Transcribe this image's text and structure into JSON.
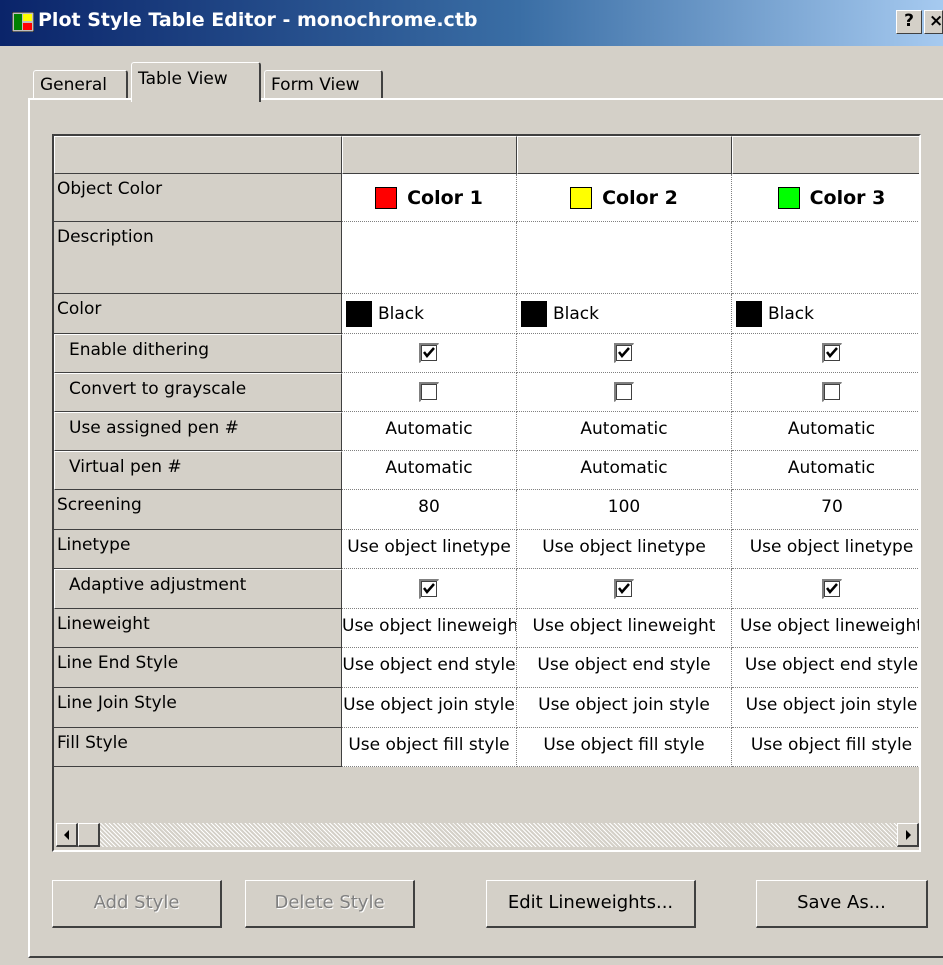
{
  "window": {
    "title": "Plot Style Table Editor - monochrome.ctb",
    "help_label": "?",
    "close_label": "×"
  },
  "tabs": [
    {
      "label": "General",
      "active": false
    },
    {
      "label": "Table View",
      "active": true
    },
    {
      "label": "Form View",
      "active": false
    }
  ],
  "row_labels": {
    "object_color": "Object Color",
    "description": "Description",
    "color": "Color",
    "enable_dithering": "Enable dithering",
    "convert_grayscale": "Convert to grayscale",
    "use_assigned_pen": "Use assigned pen #",
    "virtual_pen": "Virtual pen #",
    "screening": "Screening",
    "linetype": "Linetype",
    "adaptive_adjustment": "Adaptive adjustment",
    "lineweight": "Lineweight",
    "line_end_style": "Line End Style",
    "line_join_style": "Line Join Style",
    "fill_style": "Fill Style"
  },
  "columns": [
    {
      "object_color": "Color 1",
      "swatch": "#ff0000",
      "description": "",
      "color": "Black",
      "enable_dithering": true,
      "convert_grayscale": false,
      "use_assigned_pen": "Automatic",
      "virtual_pen": "Automatic",
      "screening": "80",
      "linetype": "Use object linetype",
      "adaptive_adjustment": true,
      "lineweight": "Use object lineweight",
      "line_end_style": "Use object end style",
      "line_join_style": "Use object join style",
      "fill_style": "Use object fill style"
    },
    {
      "object_color": "Color 2",
      "swatch": "#ffff00",
      "description": "",
      "color": "Black",
      "enable_dithering": true,
      "convert_grayscale": false,
      "use_assigned_pen": "Automatic",
      "virtual_pen": "Automatic",
      "screening": "100",
      "linetype": "Use object linetype",
      "adaptive_adjustment": true,
      "lineweight": "Use object lineweight",
      "line_end_style": "Use object end style",
      "line_join_style": "Use object join style",
      "fill_style": "Use object fill style"
    },
    {
      "object_color": "Color 3",
      "swatch": "#00ff00",
      "description": "",
      "color": "Black",
      "enable_dithering": true,
      "convert_grayscale": false,
      "use_assigned_pen": "Automatic",
      "virtual_pen": "Automatic",
      "screening": "70",
      "linetype": "Use object linetype",
      "adaptive_adjustment": true,
      "lineweight": "Use object lineweight",
      "line_end_style": "Use object end style",
      "line_join_style": "Use object join style",
      "fill_style": "Use object fill style"
    }
  ],
  "buttons": {
    "add_style": "Add Style",
    "delete_style": "Delete Style",
    "edit_lineweights": "Edit Lineweights...",
    "save_as": "Save As..."
  }
}
